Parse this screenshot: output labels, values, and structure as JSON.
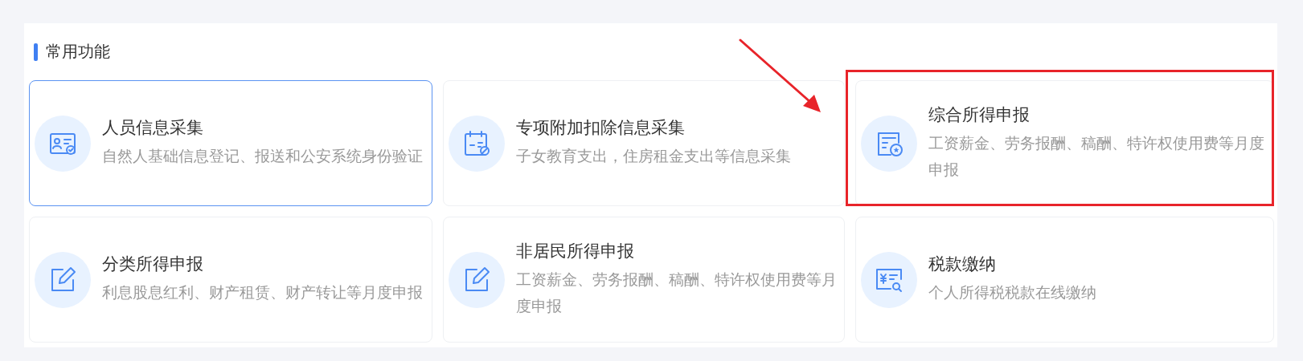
{
  "section": {
    "title": "常用功能"
  },
  "cards": [
    {
      "title": "人员信息采集",
      "description": "自然人基础信息登记、报送和公安系统身份验证",
      "selected": true,
      "highlighted": false
    },
    {
      "title": "专项附加扣除信息采集",
      "description": "子女教育支出，住房租金支出等信息采集",
      "selected": false,
      "highlighted": false
    },
    {
      "title": "综合所得申报",
      "description": "工资薪金、劳务报酬、稿酬、特许权使用费等月度申报",
      "selected": false,
      "highlighted": true
    },
    {
      "title": "分类所得申报",
      "description": "利息股息红利、财产租赁、财产转让等月度申报",
      "selected": false,
      "highlighted": false
    },
    {
      "title": "非居民所得申报",
      "description": "工资薪金、劳务报酬、稿酬、特许权使用费等月度申报",
      "selected": false,
      "highlighted": false
    },
    {
      "title": "税款缴纳",
      "description": "个人所得税税款在线缴纳",
      "selected": false,
      "highlighted": false
    }
  ]
}
